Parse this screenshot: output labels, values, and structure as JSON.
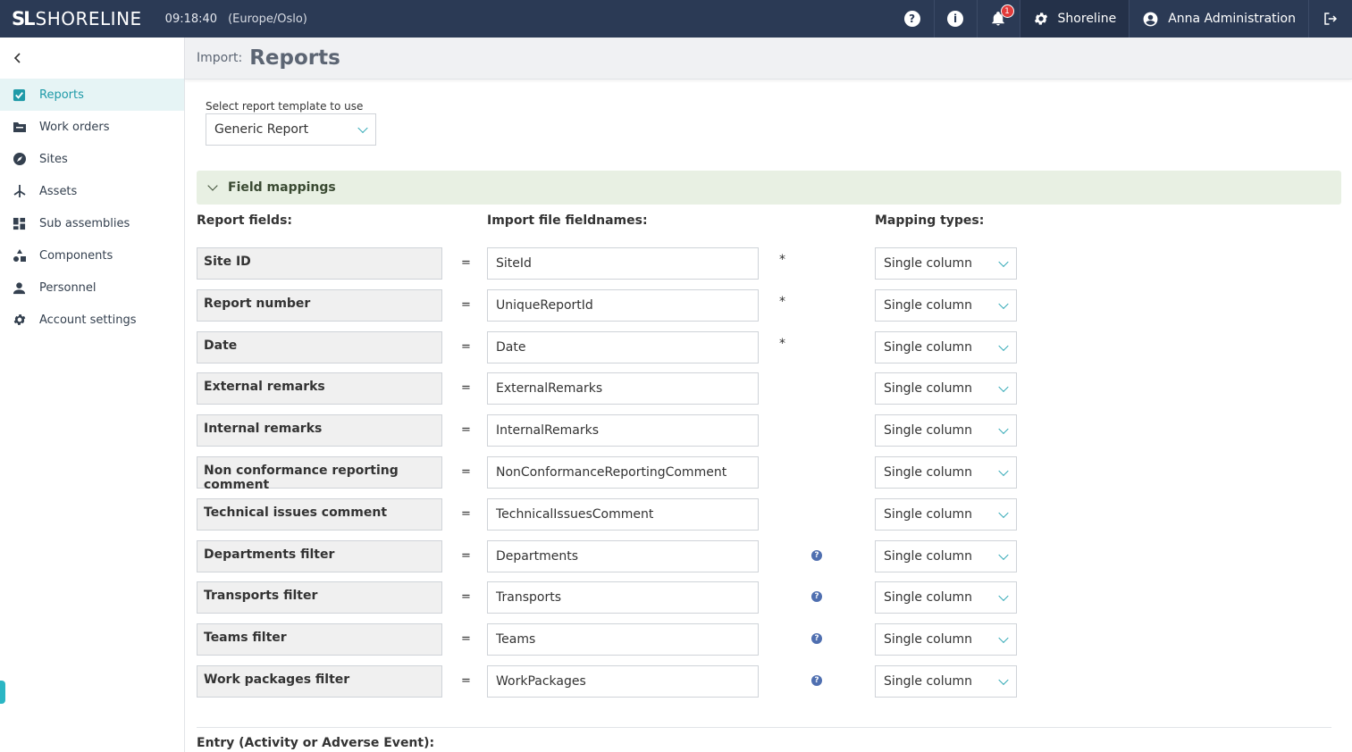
{
  "topbar": {
    "logo_mark": "SL",
    "logo_text": "SHORELINE",
    "time": "09:18:40",
    "timezone": "(Europe/Oslo)",
    "notification_count": "1",
    "tenant": "Shoreline",
    "user": "Anna Administration"
  },
  "sidebar": {
    "items": [
      {
        "label": "Reports",
        "icon": "report-check-icon",
        "active": true
      },
      {
        "label": "Work orders",
        "icon": "folder-icon",
        "active": false
      },
      {
        "label": "Sites",
        "icon": "compass-icon",
        "active": false
      },
      {
        "label": "Assets",
        "icon": "wind-turbine-icon",
        "active": false
      },
      {
        "label": "Sub assemblies",
        "icon": "dashboard-grid-icon",
        "active": false
      },
      {
        "label": "Components",
        "icon": "shapes-icon",
        "active": false
      },
      {
        "label": "Personnel",
        "icon": "person-icon",
        "active": false
      },
      {
        "label": "Account settings",
        "icon": "gear-icon",
        "active": false
      }
    ]
  },
  "header": {
    "subtitle": "Import:",
    "title": "Reports"
  },
  "template": {
    "label": "Select report template to use",
    "value": "Generic Report"
  },
  "field_mappings": {
    "title": "Field mappings",
    "col_report_fields": "Report fields:",
    "col_import_names": "Import file fieldnames:",
    "col_mapping_types": "Mapping types:",
    "eq": "=",
    "rows": [
      {
        "field": "Site ID",
        "import": "SiteId",
        "marker": "*",
        "mapping": "Single column"
      },
      {
        "field": "Report number",
        "import": "UniqueReportId",
        "marker": "*",
        "mapping": "Single column"
      },
      {
        "field": "Date",
        "import": "Date",
        "marker": "*",
        "mapping": "Single column"
      },
      {
        "field": "External remarks",
        "import": "ExternalRemarks",
        "marker": "",
        "mapping": "Single column"
      },
      {
        "field": "Internal remarks",
        "import": "InternalRemarks",
        "marker": "",
        "mapping": "Single column"
      },
      {
        "field": "Non conformance reporting comment",
        "import": "NonConformanceReportingComment",
        "marker": "",
        "mapping": "Single column"
      },
      {
        "field": "Technical issues comment",
        "import": "TechnicalIssuesComment",
        "marker": "",
        "mapping": "Single column"
      },
      {
        "field": "Departments filter",
        "import": "Departments",
        "marker": "help",
        "mapping": "Single column"
      },
      {
        "field": "Transports filter",
        "import": "Transports",
        "marker": "help",
        "mapping": "Single column"
      },
      {
        "field": "Teams filter",
        "import": "Teams",
        "marker": "help",
        "mapping": "Single column"
      },
      {
        "field": "Work packages filter",
        "import": "WorkPackages",
        "marker": "help",
        "mapping": "Single column"
      }
    ]
  },
  "entry_heading": "Entry (Activity or Adverse Event):",
  "colors": {
    "topbar": "#2b3a55",
    "accent": "#1f9aa8",
    "panel": "#e8f0e3",
    "badge": "#e23b3b"
  }
}
